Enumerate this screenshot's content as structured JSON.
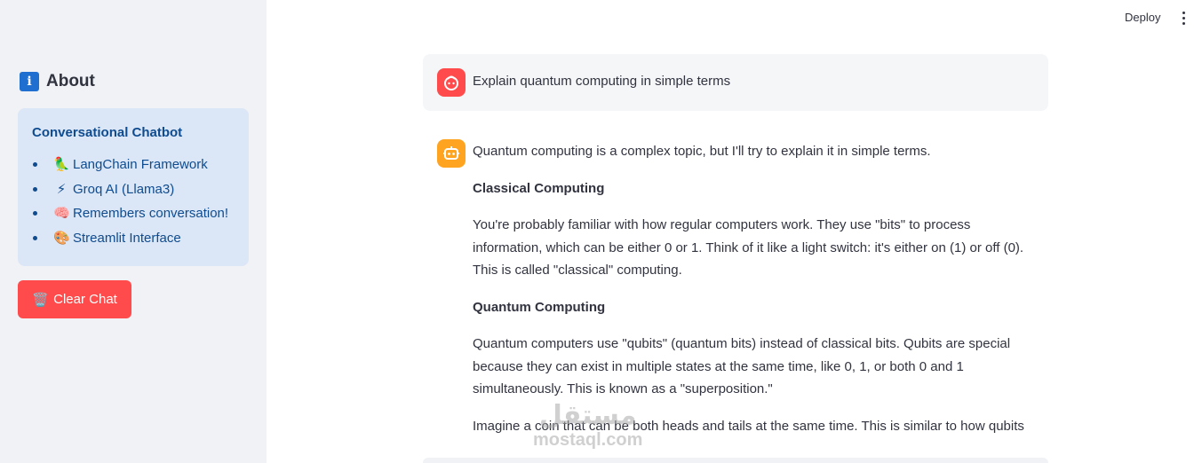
{
  "header": {
    "deploy_label": "Deploy",
    "menu_icon": "more-vertical-icon"
  },
  "sidebar": {
    "about_icon": "info-icon",
    "about_icon_glyph": "i",
    "about_title": "About",
    "info_title": "Conversational Chatbot",
    "items": [
      {
        "emoji": "🦜",
        "label": "LangChain Framework"
      },
      {
        "emoji": "⚡",
        "label": "Groq AI (Llama3)"
      },
      {
        "emoji": "🧠",
        "label": "Remembers conversation!"
      },
      {
        "emoji": "🎨",
        "label": "Streamlit Interface"
      }
    ],
    "clear_button": {
      "emoji": "🗑️",
      "label": "Clear Chat"
    }
  },
  "chat": {
    "messages": [
      {
        "role": "user",
        "avatar_icon": "user-face-icon",
        "text": "Explain quantum computing in simple terms"
      },
      {
        "role": "assistant",
        "avatar_icon": "robot-icon",
        "paragraphs": [
          "Quantum computing is a complex topic, but I'll try to explain it in simple terms.",
          "Classical Computing",
          "You're probably familiar with how regular computers work. They use \"bits\" to process information, which can be either 0 or 1. Think of it like a light switch: it's either on (1) or off (0). This is called \"classical\" computing.",
          "Quantum Computing",
          "Quantum computers use \"qubits\" (quantum bits) instead of classical bits. Qubits are special because they can exist in multiple states at the same time, like 0, 1, or both 0 and 1 simultaneously. This is known as a \"superposition.\"",
          "Imagine a coin that can be both heads and tails at the same time. This is similar to how qubits"
        ]
      }
    ]
  },
  "watermark": {
    "arabic": "مستقل",
    "latin": "mostaql.com"
  },
  "colors": {
    "sidebar_bg": "#f0f2f6",
    "info_bg": "#dbe6f6",
    "info_text": "#0f4c8f",
    "primary_red": "#ff4b4b",
    "bot_avatar": "#ffa421"
  }
}
